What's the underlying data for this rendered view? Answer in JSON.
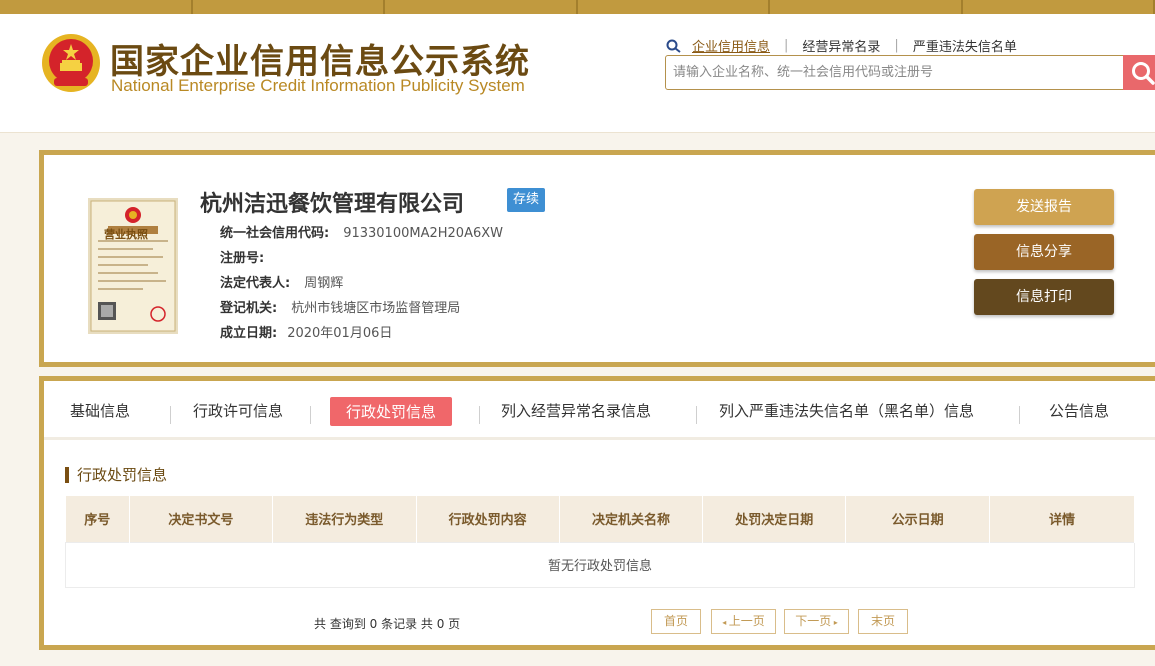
{
  "header": {
    "title_cn": "国家企业信用信息公示系统",
    "title_en": "National Enterprise Credit Information Publicity System",
    "links": [
      "企业信用信息",
      "经营异常名录",
      "严重违法失信名单"
    ],
    "search_placeholder": "请输入企业名称、统一社会信用代码或注册号"
  },
  "company": {
    "name": "杭州洁迅餐饮管理有限公司",
    "status": "存续",
    "license_label": "营业执照",
    "fields": [
      {
        "label": "统一社会信用代码:",
        "value": "91330100MA2H20A6XW"
      },
      {
        "label": "注册号:",
        "value": ""
      },
      {
        "label": "法定代表人:",
        "value": "周钢辉"
      },
      {
        "label": "登记机关:",
        "value": "杭州市钱塘区市场监督管理局"
      },
      {
        "label": "成立日期:",
        "value": "2020年01月06日"
      }
    ],
    "actions": [
      "发送报告",
      "信息分享",
      "信息打印"
    ]
  },
  "tabs": [
    "基础信息",
    "行政许可信息",
    "行政处罚信息",
    "列入经营异常名录信息",
    "列入严重违法失信名单（黑名单）信息",
    "公告信息"
  ],
  "section": {
    "title": "行政处罚信息",
    "columns": [
      "序号",
      "决定书文号",
      "违法行为类型",
      "行政处罚内容",
      "决定机关名称",
      "处罚决定日期",
      "公示日期",
      "详情"
    ],
    "empty_text": "暂无行政处罚信息"
  },
  "pager": {
    "summary": "共 查询到 0 条记录 共 0 页",
    "first": "首页",
    "prev": "上一页",
    "next": "下一页",
    "last": "末页"
  },
  "colors": {
    "gold": "#c9a650",
    "brown_dark": "#6b4a12",
    "active_tab": "#f0676a",
    "status_blue": "#3e8fd3",
    "btn_send": "#cfa351",
    "btn_share": "#9a6526",
    "btn_print": "#63481e"
  }
}
